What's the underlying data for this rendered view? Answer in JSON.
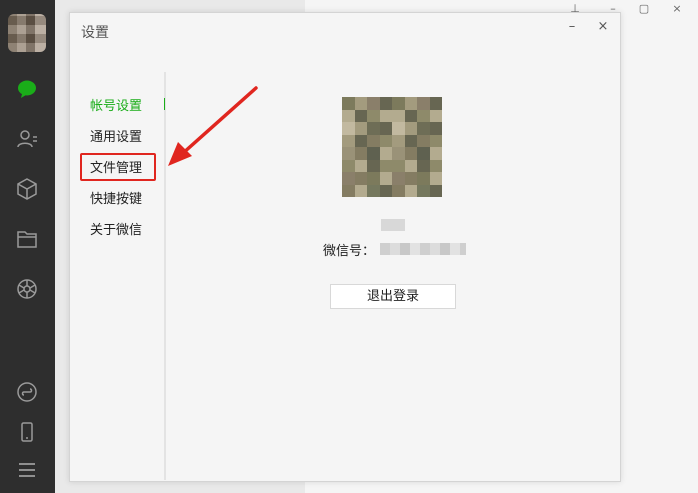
{
  "dialog": {
    "title": "设置",
    "minimize_glyph": "–",
    "close_glyph": "×"
  },
  "main_window": {
    "pin_glyph": "⊥",
    "minimize_glyph": "–",
    "maximize_glyph": "▢",
    "close_glyph": "×"
  },
  "nav": {
    "items": [
      {
        "label": "帐号设置",
        "active": true
      },
      {
        "label": "通用设置",
        "active": false
      },
      {
        "label": "文件管理",
        "active": false
      },
      {
        "label": "快捷按键",
        "active": false
      },
      {
        "label": "关于微信",
        "active": false
      }
    ]
  },
  "account": {
    "wxid_label": "微信号：",
    "logout_label": "退出登录"
  },
  "sidebar": {
    "icons": [
      "chat-icon",
      "contacts-icon",
      "favorites-icon",
      "files-icon",
      "moments-icon",
      "mini-programs-icon",
      "phone-icon",
      "menu-icon"
    ]
  },
  "colors": {
    "accent": "#1aad19",
    "annotation": "#e0261f",
    "sidebar": "#2e2e2e"
  }
}
